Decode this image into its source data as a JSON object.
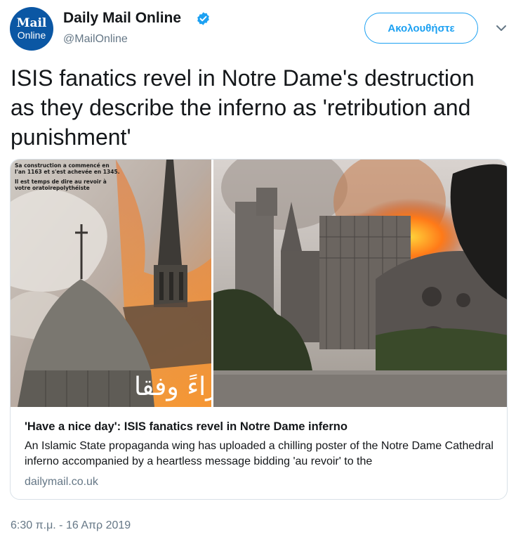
{
  "account": {
    "logo_line1": "Mail",
    "logo_line2": "Online",
    "name": "Daily Mail Online",
    "handle": "@MailOnline",
    "follow_label": "Ακολουθήστε"
  },
  "tweet": {
    "text": "ISIS fanatics revel in Notre Dame's destruction as they describe the inferno as 'retribution and punishment'",
    "timestamp": "6:30 π.μ. - 16 Απρ 2019"
  },
  "card": {
    "poster_caption_1": "Sa construction a commencé en",
    "poster_caption_2": "l'an 1163 et s'est achevée en 1345.",
    "poster_caption_3": "Il est temps de dire au revoir à",
    "poster_caption_4": "votre oratoirepolythéiste",
    "arabic_text": "جزاءً وفقا",
    "title": "'Have a nice day': ISIS fanatics revel in Notre Dame inferno",
    "description": "An Islamic State propaganda wing has uploaded a chilling poster of the Notre Dame Cathedral inferno accompanied by a heartless message bidding 'au revoir' to the",
    "domain": "dailymail.co.uk"
  },
  "colors": {
    "accent": "#1da1f2",
    "brand": "#0b57a4",
    "secondary_text": "#657786"
  },
  "icons": [
    "verified-badge-icon",
    "chevron-down-icon"
  ]
}
